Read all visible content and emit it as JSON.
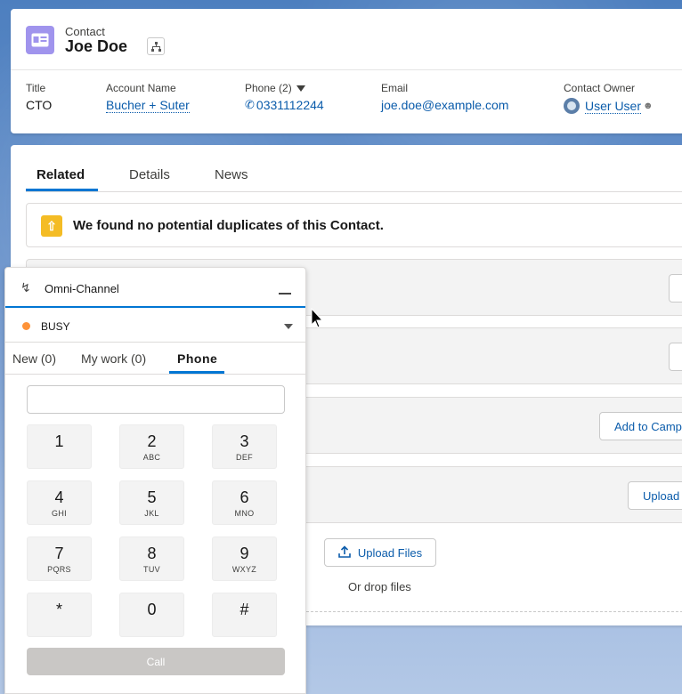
{
  "record": {
    "entity_label": "Contact",
    "name": "Joe Doe",
    "fields": {
      "title_label": "Title",
      "title_value": "CTO",
      "account_label": "Account Name",
      "account_value": "Bucher + Suter",
      "phone_label": "Phone (2)",
      "phone_value": "0331112244",
      "email_label": "Email",
      "email_value": "joe.doe@example.com",
      "owner_label": "Contact Owner",
      "owner_value": "User User"
    }
  },
  "tabs": [
    "Related",
    "Details",
    "News"
  ],
  "duplicate_banner": "We found no potential duplicates of this Contact.",
  "related": {
    "add_to_campaign": "Add to Camp",
    "upload": "Upload",
    "upload_files": "Upload Files",
    "drop_files": "Or drop files"
  },
  "omni": {
    "title": "Omni-Channel",
    "status": "BUSY",
    "status_color": "#fe9339",
    "tabs": [
      "New (0)",
      "My work (0)",
      "Phone"
    ],
    "keys": [
      {
        "digit": "1",
        "letters": ""
      },
      {
        "digit": "2",
        "letters": "ABC"
      },
      {
        "digit": "3",
        "letters": "DEF"
      },
      {
        "digit": "4",
        "letters": "GHI"
      },
      {
        "digit": "5",
        "letters": "JKL"
      },
      {
        "digit": "6",
        "letters": "MNO"
      },
      {
        "digit": "7",
        "letters": "PQRS"
      },
      {
        "digit": "8",
        "letters": "TUV"
      },
      {
        "digit": "9",
        "letters": "WXYZ"
      },
      {
        "digit": "*",
        "letters": ""
      },
      {
        "digit": "0",
        "letters": ""
      },
      {
        "digit": "#",
        "letters": ""
      }
    ],
    "call_label": "Call",
    "dial_value": ""
  },
  "icons": {
    "contact": "contact-card-icon",
    "hierarchy": "hierarchy-icon",
    "phone": "phone-icon",
    "duplicate": "duplicate-icon",
    "upload": "upload-icon",
    "omni": "omni-channel-icon"
  },
  "colors": {
    "brand": "#0176d3",
    "link": "#0b5cab",
    "contact_icon": "#a094ed",
    "duplicate_icon": "#f4bc25"
  }
}
